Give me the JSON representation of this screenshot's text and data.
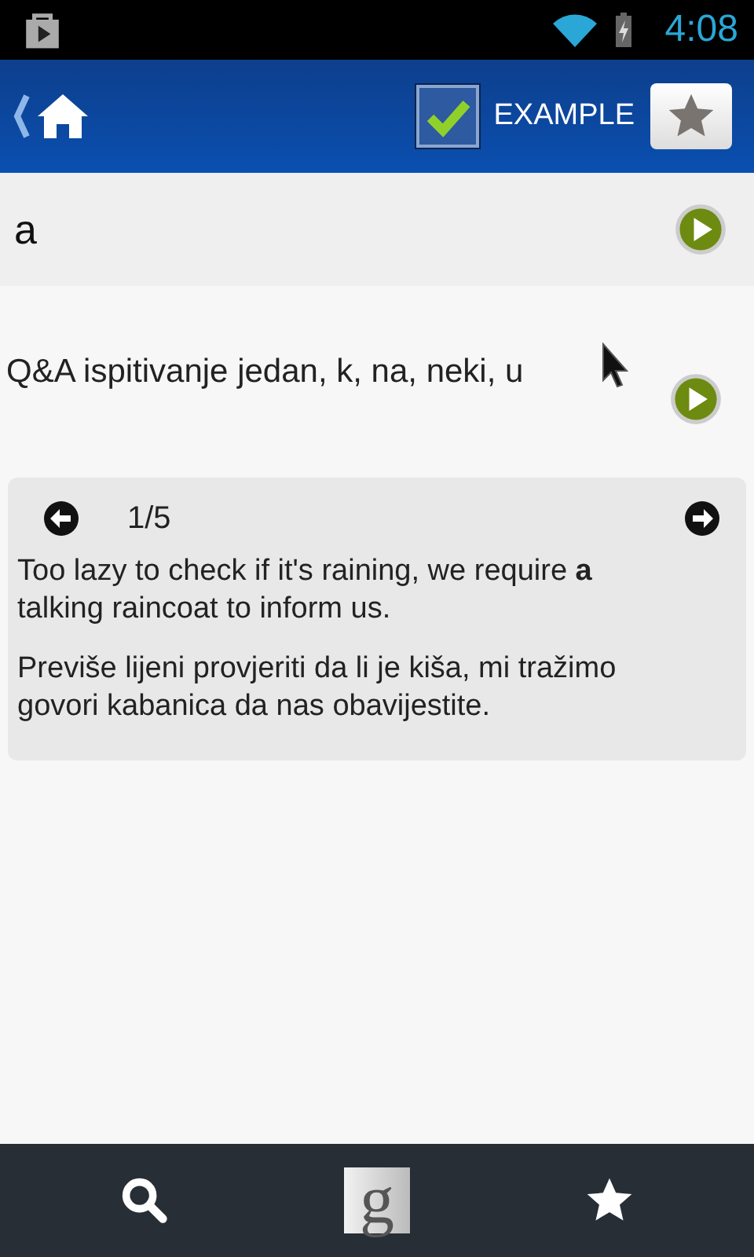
{
  "status_bar": {
    "time": "4:08"
  },
  "header": {
    "checkbox": {
      "label": "EXAMPLE",
      "checked": true
    }
  },
  "word": {
    "text": "a"
  },
  "translation": {
    "text": "Q&A ispitivanje jedan, k, na, neki, u"
  },
  "example": {
    "counter": "1/5",
    "sentences": [
      "Too lazy to check if it's raining, we require **a** talking raincoat to inform us.",
      "Previše lijeni provjeriti da li je kiša, mi tražimo govori kabanica da nas obavijestite."
    ]
  },
  "bottom_bar": {
    "buttons": [
      {
        "kind": "search"
      },
      {
        "kind": "google",
        "label": "g"
      },
      {
        "kind": "favorites"
      }
    ]
  }
}
